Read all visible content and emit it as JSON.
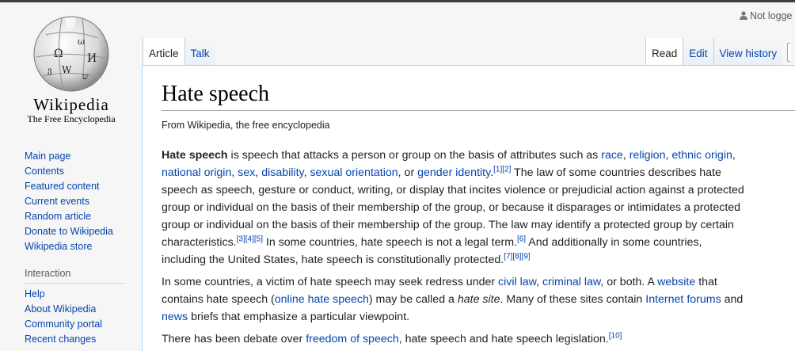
{
  "logo": {
    "wordmark": "Wikipedia",
    "tagline": "The Free Encyclopedia"
  },
  "personal": {
    "not_logged_in": "Not logge"
  },
  "sidebar": {
    "main_links": [
      "Main page",
      "Contents",
      "Featured content",
      "Current events",
      "Random article",
      "Donate to Wikipedia",
      "Wikipedia store"
    ],
    "interaction_heading": "Interaction",
    "interaction_links": [
      "Help",
      "About Wikipedia",
      "Community portal",
      "Recent changes"
    ]
  },
  "tabs": {
    "article": "Article",
    "talk": "Talk",
    "read": "Read",
    "edit": "Edit",
    "view_history": "View history"
  },
  "article": {
    "title": "Hate speech",
    "tagline": "From Wikipedia, the free encyclopedia",
    "p1": {
      "l1": {
        "bold": "Hate speech",
        "t1": " is speech that attacks a person or group on the basis of attributes such as ",
        "race": "race",
        "c1": ", ",
        "religion": "religion",
        "c2": ", ",
        "ethnic": "ethnic origin",
        "c3": ","
      },
      "l2": {
        "national": "national origin",
        "c1": ", ",
        "sex": "sex",
        "c2": ", ",
        "disability": "disability",
        "c3": ", ",
        "sexual": "sexual orientation",
        "c4": ", or ",
        "gender": "gender identity",
        "dot": ".",
        "r1": "[1]",
        "r2": "[2]",
        "t": " The law of some countries describes hate"
      },
      "l3": "speech as speech, gesture or conduct, writing, or display that incites violence or prejudicial action against a protected",
      "l4": "group or individual on the basis of their membership of the group, or because it disparages or intimidates a protected",
      "l5": "group or individual on the basis of their membership of the group. The law may identify a protected group by certain",
      "l6": {
        "t1": "characteristics.",
        "r3": "[3]",
        "r4": "[4]",
        "r5": "[5]",
        "t2": " In some countries, hate speech is not a legal term.",
        "r6": "[6]",
        "t3": " And additionally in some countries,"
      },
      "l7": {
        "t": "including the United States, hate speech is constitutionally protected.",
        "r7": "[7]",
        "r8": "[8]",
        "r9": "[9]"
      }
    },
    "p2": {
      "l1": {
        "t1": "In some countries, a victim of hate speech may seek redress under ",
        "civil": "civil law",
        "c1": ", ",
        "criminal": "criminal law",
        "t2": ", or both. A ",
        "website": "website",
        "t3": " that"
      },
      "l2": {
        "t1": "contains hate speech (",
        "online": "online hate speech",
        "t2": ") may be called a ",
        "hate_site": "hate site",
        "t3": ". Many of these sites contain ",
        "forums": "Internet forums",
        "t4": " and"
      },
      "l3": {
        "news": "news",
        "t": " briefs that emphasize a particular viewpoint."
      }
    },
    "p3": {
      "t1": "There has been debate over ",
      "freedom": "freedom of speech",
      "t2": ", hate speech and hate speech legislation.",
      "r10": "[10]"
    }
  },
  "colors": {
    "link": "#0645ad",
    "page_bg": "#f6f6f6",
    "content_border": "#a7d7f9"
  }
}
